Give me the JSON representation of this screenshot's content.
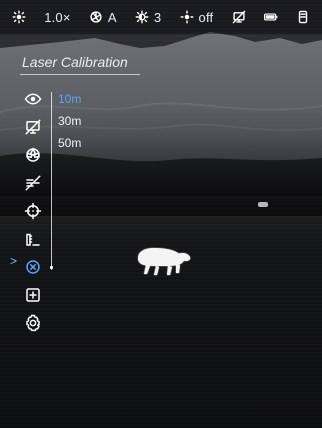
{
  "status_bar": {
    "brightness_icon": "sun-icon",
    "zoom": "1.0×",
    "calibration_mode_icon": "shutter-icon",
    "calibration_mode": "A",
    "contrast_icon": "contrast-sun-icon",
    "contrast_level": "3",
    "ir_icon": "ir-sun-icon",
    "ir_state": "off",
    "display_off_icon": "display-off-icon",
    "battery_icon": "battery-icon",
    "storage_icon": "storage-icon"
  },
  "title": "Laser Calibration",
  "menu": {
    "items": [
      {
        "name": "eye",
        "icon": "eye-icon"
      },
      {
        "name": "display-off",
        "icon": "display-off-icon"
      },
      {
        "name": "color-palette",
        "icon": "palette-icon"
      },
      {
        "name": "no-laser",
        "icon": "laser-off-icon"
      },
      {
        "name": "crosshair",
        "icon": "crosshair-icon"
      },
      {
        "name": "ruler",
        "icon": "ruler-icon"
      },
      {
        "name": "laser-calibration",
        "icon": "laser-calibration-icon"
      },
      {
        "name": "add",
        "icon": "add-icon"
      },
      {
        "name": "settings",
        "icon": "gear-icon"
      }
    ],
    "active_index": 6,
    "pointer": ">"
  },
  "options": {
    "items": [
      "10m",
      "30m",
      "50m"
    ],
    "selected": "10m"
  },
  "colors": {
    "accent": "#58a6ff",
    "text": "#e9eef3"
  }
}
